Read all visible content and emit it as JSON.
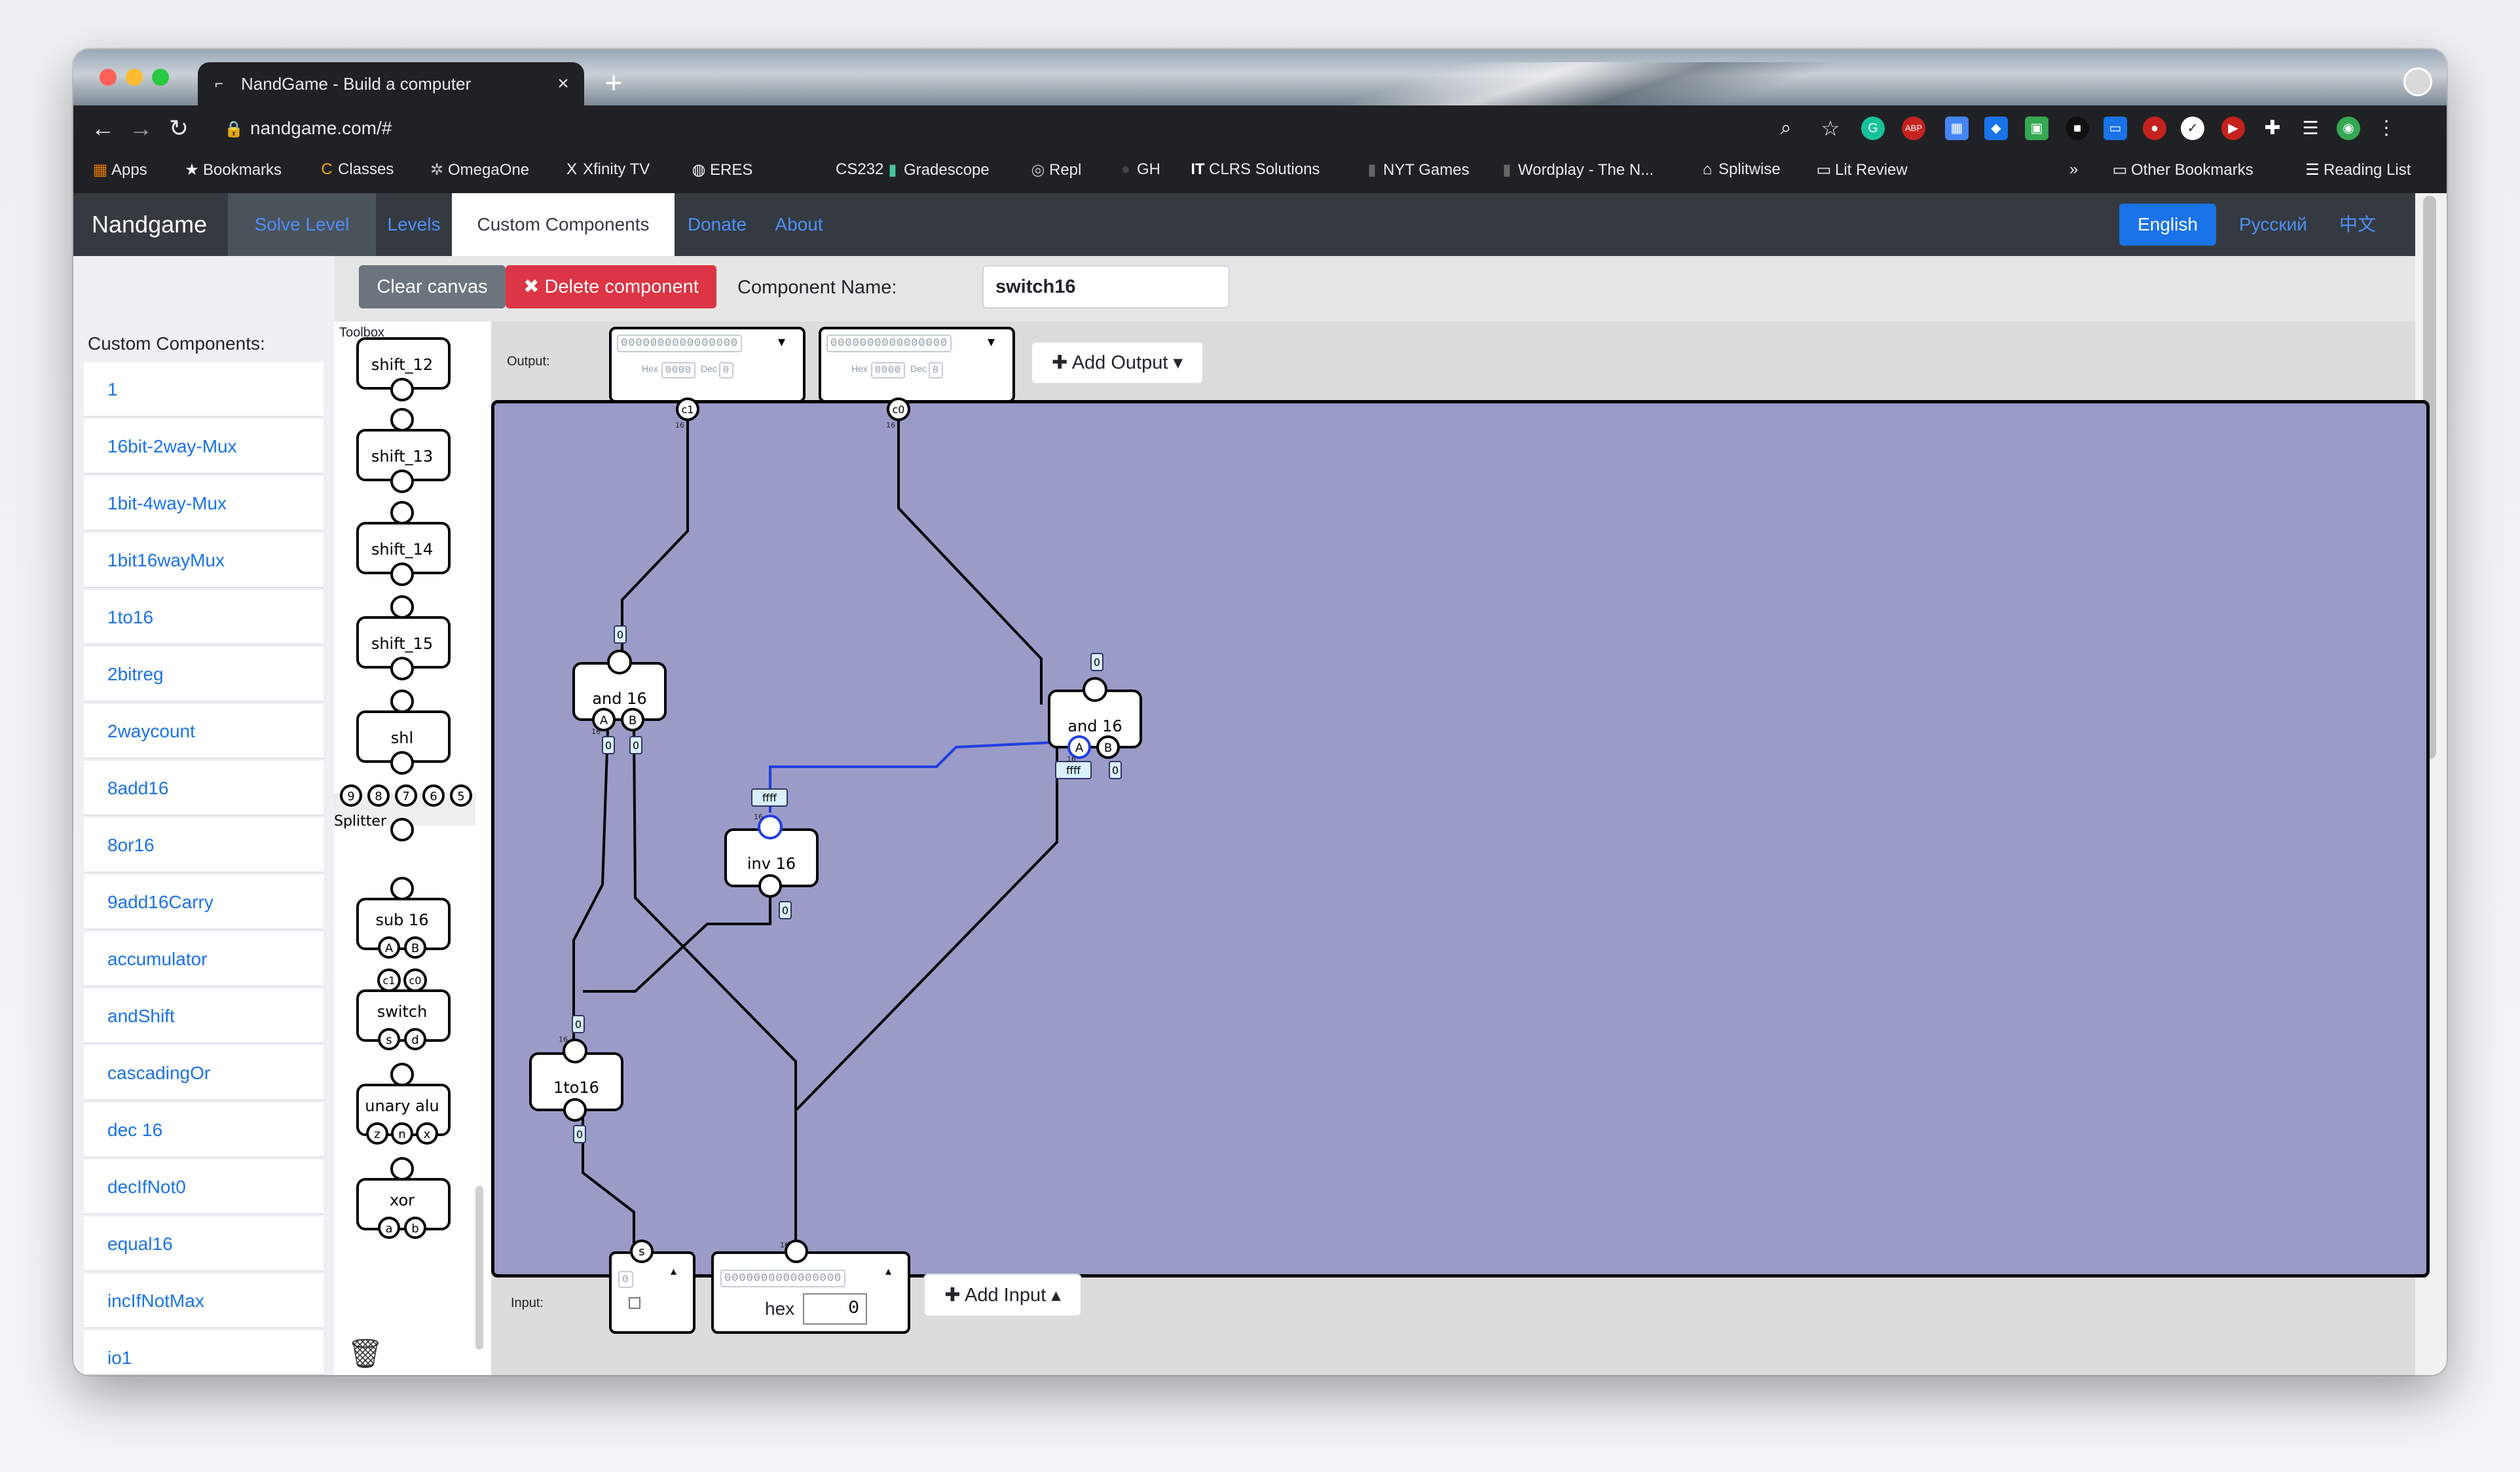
{
  "browser": {
    "tab_title": "NandGame - Build a computer",
    "url": "nandgame.com/#",
    "bookmarks": [
      "Apps",
      "Bookmarks",
      "Classes",
      "OmegaOne",
      "Xfinity TV",
      "ERES",
      "CS232",
      "Gradescope",
      "Repl",
      "GH",
      "CLRS Solutions",
      "NYT Games",
      "Wordplay - The N...",
      "Splitwise",
      "Lit Review"
    ],
    "bookmarks_overflow": "»",
    "other_bookmarks": "Other Bookmarks",
    "reading_list": "Reading List",
    "ext_labels": [
      "ABP"
    ]
  },
  "nav": {
    "brand": "Nandgame",
    "links": [
      "Solve Level",
      "Levels",
      "Custom Components",
      "Donate",
      "About"
    ],
    "active": "Custom Components",
    "languages": [
      "English",
      "Русский",
      "中文"
    ],
    "active_language": "English"
  },
  "sidebar": {
    "title": "Custom Components:",
    "items": [
      "1",
      "16bit-2way-Mux",
      "1bit-4way-Mux",
      "1bit16wayMux",
      "1to16",
      "2bitreg",
      "2waycount",
      "8add16",
      "8or16",
      "9add16Carry",
      "accumulator",
      "andShift",
      "cascadingOr",
      "dec 16",
      "decIfNot0",
      "equal16",
      "incIfNotMax",
      "io1"
    ]
  },
  "editor": {
    "clear_canvas": "Clear canvas",
    "delete_component": "✖ Delete component",
    "component_name_label": "Component Name:",
    "component_name_value": "switch16",
    "toolbox_title": "Toolbox",
    "toolbox_items": [
      "shift_12",
      "shift_13",
      "shift_14",
      "shift_15",
      "shl",
      "Splitter",
      "sub 16",
      "switch",
      "unary alu",
      "xor"
    ],
    "toolbox_pin_labels": {
      "splitter": [
        "9",
        "8",
        "7",
        "6",
        "5"
      ],
      "sub16": [
        "A",
        "B"
      ],
      "switch_in": [
        "c1",
        "c0"
      ],
      "switch_out": [
        "s",
        "d"
      ],
      "unary_alu": [
        "z",
        "n",
        "x"
      ],
      "xor": [
        "a",
        "b"
      ]
    },
    "output_label": "Output:",
    "outputs": [
      {
        "pin": "c1",
        "binary": "0000000000000000",
        "hex_label": "Hex",
        "hex": "0000",
        "dec_label": "Dec",
        "dec": "0"
      },
      {
        "pin": "c0",
        "binary": "0000000000000000",
        "hex_label": "Hex",
        "hex": "0000",
        "dec_label": "Dec",
        "dec": "0"
      }
    ],
    "add_output": "Add Output",
    "input_label": "Input:",
    "inputs": [
      {
        "pin": "s",
        "value": "0"
      },
      {
        "pin": "",
        "binary": "0000000000000000",
        "hex_label": "hex",
        "hex": "0"
      }
    ],
    "add_input": "Add Input"
  },
  "canvas": {
    "components": [
      {
        "label": "and 16",
        "pins": [
          "A",
          "B"
        ],
        "in_values": [
          "0",
          "0"
        ],
        "out_value": "0"
      },
      {
        "label": "and 16",
        "pins": [
          "A",
          "B"
        ],
        "in_values": [
          "ffff",
          "0"
        ],
        "out_value": "0"
      },
      {
        "label": "inv 16",
        "in_value": "0",
        "out_value": "ffff"
      },
      {
        "label": "1to16",
        "in_value": "0",
        "out_value": "0"
      }
    ],
    "bus_width": "16",
    "colors": {
      "canvas": "#9b9bc8",
      "wire": "#000000",
      "active_wire": "#1f3fe0"
    }
  },
  "colors": {
    "navbar": "#343a40",
    "link": "#4f8ff7",
    "accent": "#1a73e8",
    "danger": "#dc3545"
  }
}
